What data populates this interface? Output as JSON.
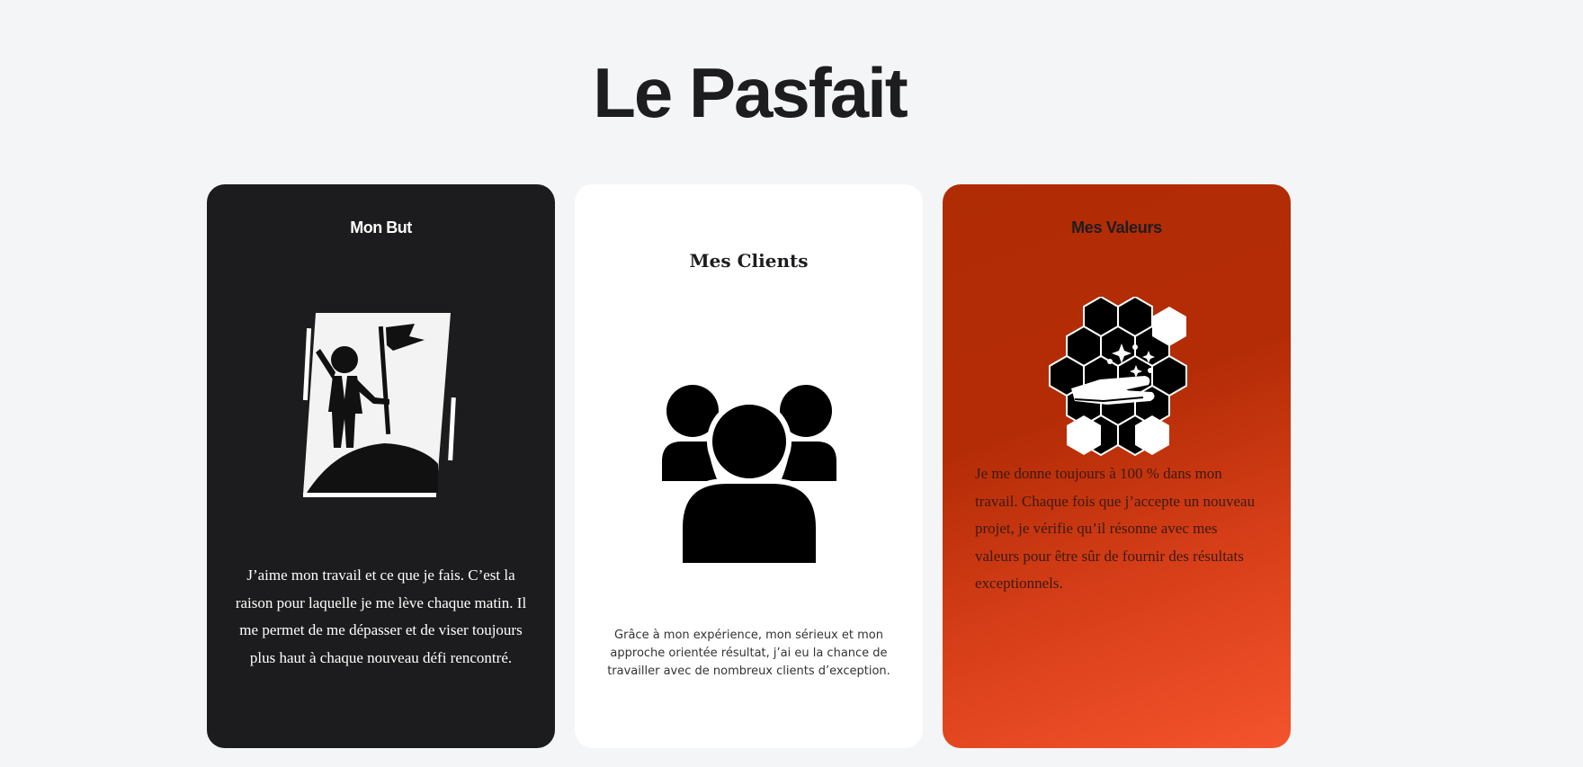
{
  "page": {
    "title": "Le Pasfait"
  },
  "cards": [
    {
      "title": "Mon But",
      "icon": "summit-flag-icon",
      "text": "J’aime mon travail et ce que je fais. C’est la raison pour laquelle je me lève chaque matin. Il me permet de me dépasser et de viser toujours plus haut à chaque nouveau défi rencontré.",
      "background": "#1c1c1e"
    },
    {
      "title": "Mes Clients",
      "icon": "group-users-icon",
      "text": "Grâce à mon expérience, mon sérieux et mon approche orientée résultat, j’ai eu la chance de travailler avec de nombreux clients d’exception.",
      "background": "#ffffff"
    },
    {
      "title": "Mes Valeurs",
      "icon": "hexagon-handshake-icon",
      "text": "Je me donne toujours à 100 % dans mon travail. Chaque fois que j’accepte un nouveau projet, je vérifie qu’il résonne avec mes valeurs pour être sûr de fournir des résultats exceptionnels.",
      "background": "#b42c06"
    }
  ]
}
